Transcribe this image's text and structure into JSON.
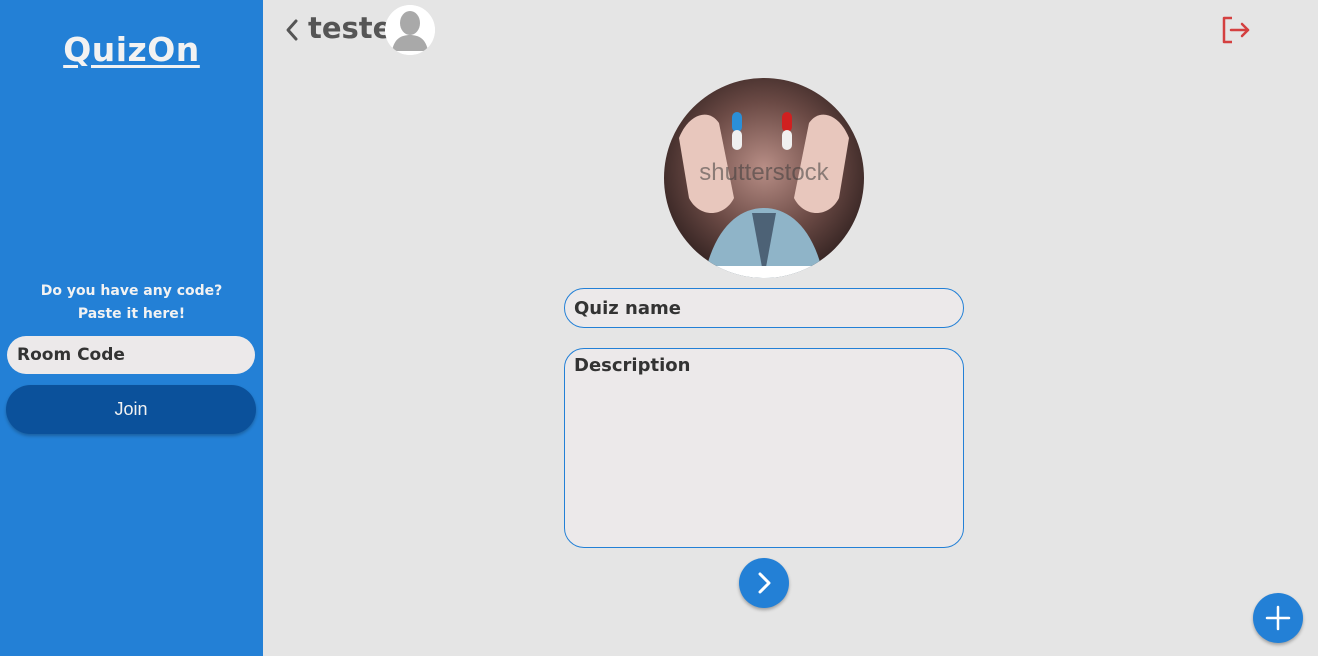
{
  "sidebar": {
    "logo": "QuizOn",
    "code_prompt_line1": "Do you have any code?",
    "code_prompt_line2": "Paste it here!",
    "room_code": {
      "value": "",
      "placeholder": "Room Code"
    },
    "join_label": "Join"
  },
  "header": {
    "back_icon": "chevron-left-icon",
    "title": "teste",
    "avatar_icon": "user-avatar-icon",
    "logout_icon": "logout-icon"
  },
  "form": {
    "image_icon": "quiz-cover-image",
    "image_watermark": "shutterstock",
    "quiz_name": {
      "value": "",
      "placeholder": "Quiz name"
    },
    "description": {
      "value": "",
      "placeholder": "Description"
    },
    "next_icon": "chevron-right-icon"
  },
  "fab": {
    "icon": "plus-icon"
  },
  "colors": {
    "primary": "#2380d6",
    "join_button": "#0b519b",
    "background": "#e5e5e5",
    "input_bg": "#ece9ea",
    "logout": "#d44040",
    "text_dark": "#333333"
  }
}
